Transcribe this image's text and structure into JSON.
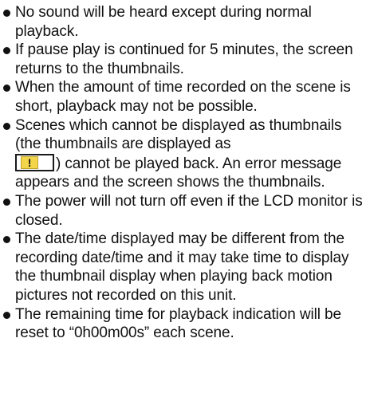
{
  "notes": [
    {
      "text": "No sound will be heard except during normal playback."
    },
    {
      "text": "If pause play is continued for 5 minutes, the screen returns to the thumbnails."
    },
    {
      "text": "When the amount of time recorded on the scene is short, playback may not be possible."
    },
    {
      "text_before": "Scenes which cannot be displayed as thumbnails (the thumbnails are displayed as",
      "icon_symbol": "!",
      "text_after": ") cannot be played back. An error message appears and the screen shows the thumbnails."
    },
    {
      "text": "The power will not turn off even if the LCD monitor is closed."
    },
    {
      "text": "The date/time displayed may be different from the recording date/time and it may take time to display the thumbnail display when playing back motion pictures not recorded on this unit."
    },
    {
      "text": "The remaining time for playback indication will be reset to “0h00m00s” each scene."
    }
  ],
  "icons": {
    "bullet": "filled-circle",
    "warning": "exclamation-thumbnail-icon"
  },
  "colors": {
    "text": "#111111",
    "warning_fill": "#f2d54b"
  }
}
